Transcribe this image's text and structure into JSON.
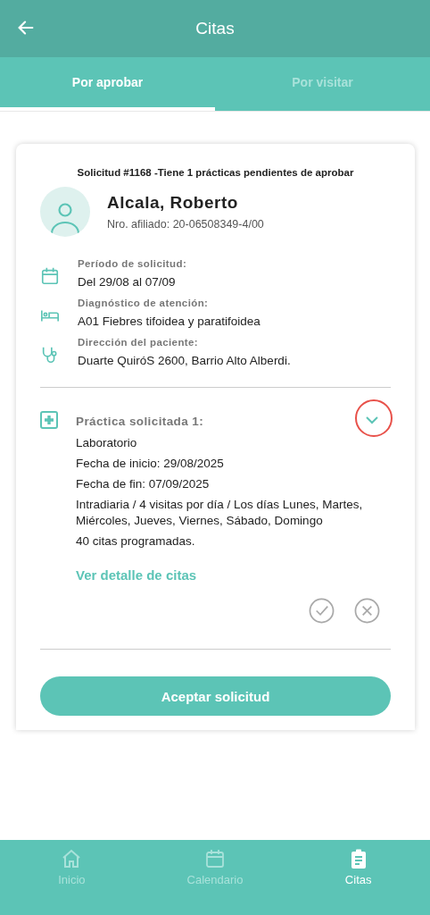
{
  "header": {
    "title": "Citas"
  },
  "tabs": [
    {
      "label": "Por aprobar",
      "selected": true
    },
    {
      "label": "Por visitar",
      "selected": false
    }
  ],
  "request": {
    "summary": "Solicitud #1168 -Tiene 1 prácticas pendientes de aprobar",
    "patient": {
      "name": "Alcala, Roberto",
      "member_number": "Nro. afiliado: 20-06508349-4/00"
    },
    "details": [
      {
        "kind": "calendar",
        "label": "Período de solicitud:",
        "value": "Del 29/08 al 07/09"
      },
      {
        "kind": "bed",
        "label": "Diagnóstico de atención:",
        "value": "A01 Fiebres tifoidea y paratifoidea"
      },
      {
        "kind": "stethoscope",
        "label": "Dirección del paciente:",
        "value": "Duarte QuiróS  2600, Barrio Alto Alberdi."
      }
    ],
    "practice": {
      "label": "Práctica solicitada 1:",
      "name": "Laboratorio",
      "lines": [
        "Fecha de inicio: 29/08/2025",
        "Fecha de fin: 07/09/2025",
        "Intradiaria / 4 visitas por día /  Los días Lunes, Martes, Miércoles, Jueves, Viernes, Sábado, Domingo",
        "40 citas programadas."
      ],
      "link": "Ver detalle de citas"
    },
    "accept_button": "Aceptar solicitud"
  },
  "nav": [
    {
      "kind": "home",
      "label": "Inicio",
      "selected": false
    },
    {
      "kind": "calendar",
      "label": "Calendario",
      "selected": false
    },
    {
      "kind": "clipboard",
      "label": "Citas",
      "selected": true
    }
  ]
}
